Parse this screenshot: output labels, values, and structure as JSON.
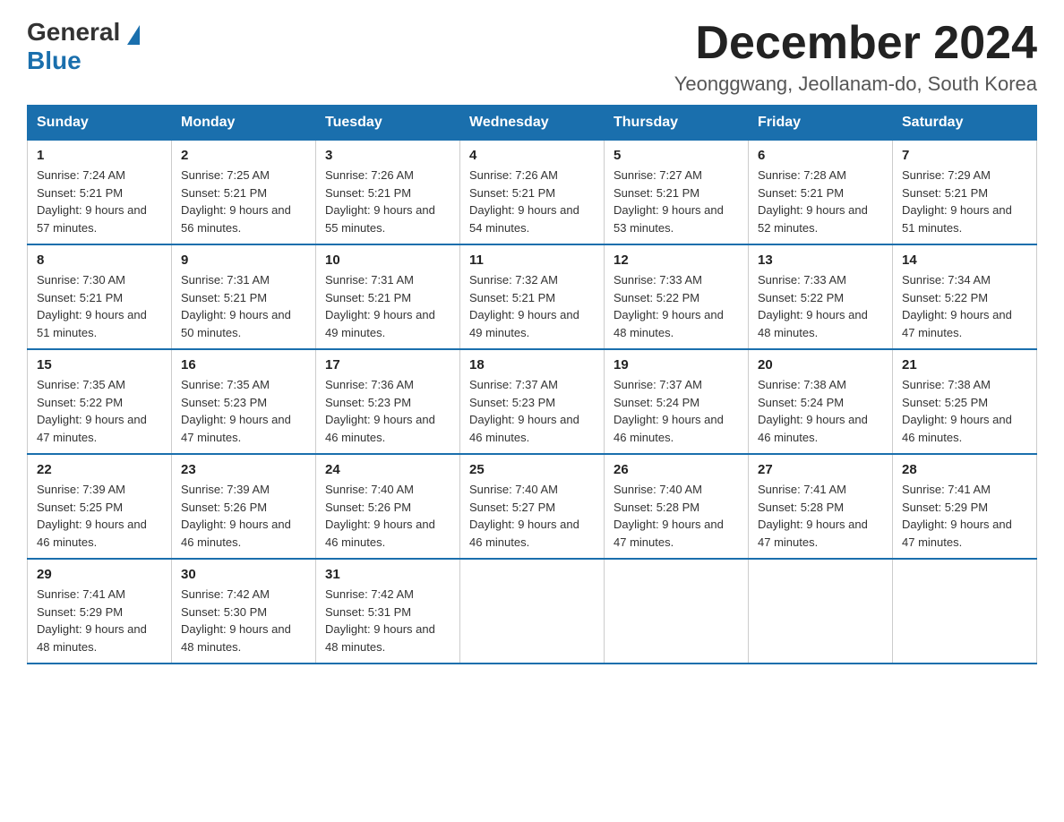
{
  "logo": {
    "general": "General",
    "blue": "Blue"
  },
  "title": "December 2024",
  "location": "Yeonggwang, Jeollanam-do, South Korea",
  "days_of_week": [
    "Sunday",
    "Monday",
    "Tuesday",
    "Wednesday",
    "Thursday",
    "Friday",
    "Saturday"
  ],
  "weeks": [
    [
      {
        "day": "1",
        "sunrise": "7:24 AM",
        "sunset": "5:21 PM",
        "daylight": "9 hours and 57 minutes."
      },
      {
        "day": "2",
        "sunrise": "7:25 AM",
        "sunset": "5:21 PM",
        "daylight": "9 hours and 56 minutes."
      },
      {
        "day": "3",
        "sunrise": "7:26 AM",
        "sunset": "5:21 PM",
        "daylight": "9 hours and 55 minutes."
      },
      {
        "day": "4",
        "sunrise": "7:26 AM",
        "sunset": "5:21 PM",
        "daylight": "9 hours and 54 minutes."
      },
      {
        "day": "5",
        "sunrise": "7:27 AM",
        "sunset": "5:21 PM",
        "daylight": "9 hours and 53 minutes."
      },
      {
        "day": "6",
        "sunrise": "7:28 AM",
        "sunset": "5:21 PM",
        "daylight": "9 hours and 52 minutes."
      },
      {
        "day": "7",
        "sunrise": "7:29 AM",
        "sunset": "5:21 PM",
        "daylight": "9 hours and 51 minutes."
      }
    ],
    [
      {
        "day": "8",
        "sunrise": "7:30 AM",
        "sunset": "5:21 PM",
        "daylight": "9 hours and 51 minutes."
      },
      {
        "day": "9",
        "sunrise": "7:31 AM",
        "sunset": "5:21 PM",
        "daylight": "9 hours and 50 minutes."
      },
      {
        "day": "10",
        "sunrise": "7:31 AM",
        "sunset": "5:21 PM",
        "daylight": "9 hours and 49 minutes."
      },
      {
        "day": "11",
        "sunrise": "7:32 AM",
        "sunset": "5:21 PM",
        "daylight": "9 hours and 49 minutes."
      },
      {
        "day": "12",
        "sunrise": "7:33 AM",
        "sunset": "5:22 PM",
        "daylight": "9 hours and 48 minutes."
      },
      {
        "day": "13",
        "sunrise": "7:33 AM",
        "sunset": "5:22 PM",
        "daylight": "9 hours and 48 minutes."
      },
      {
        "day": "14",
        "sunrise": "7:34 AM",
        "sunset": "5:22 PM",
        "daylight": "9 hours and 47 minutes."
      }
    ],
    [
      {
        "day": "15",
        "sunrise": "7:35 AM",
        "sunset": "5:22 PM",
        "daylight": "9 hours and 47 minutes."
      },
      {
        "day": "16",
        "sunrise": "7:35 AM",
        "sunset": "5:23 PM",
        "daylight": "9 hours and 47 minutes."
      },
      {
        "day": "17",
        "sunrise": "7:36 AM",
        "sunset": "5:23 PM",
        "daylight": "9 hours and 46 minutes."
      },
      {
        "day": "18",
        "sunrise": "7:37 AM",
        "sunset": "5:23 PM",
        "daylight": "9 hours and 46 minutes."
      },
      {
        "day": "19",
        "sunrise": "7:37 AM",
        "sunset": "5:24 PM",
        "daylight": "9 hours and 46 minutes."
      },
      {
        "day": "20",
        "sunrise": "7:38 AM",
        "sunset": "5:24 PM",
        "daylight": "9 hours and 46 minutes."
      },
      {
        "day": "21",
        "sunrise": "7:38 AM",
        "sunset": "5:25 PM",
        "daylight": "9 hours and 46 minutes."
      }
    ],
    [
      {
        "day": "22",
        "sunrise": "7:39 AM",
        "sunset": "5:25 PM",
        "daylight": "9 hours and 46 minutes."
      },
      {
        "day": "23",
        "sunrise": "7:39 AM",
        "sunset": "5:26 PM",
        "daylight": "9 hours and 46 minutes."
      },
      {
        "day": "24",
        "sunrise": "7:40 AM",
        "sunset": "5:26 PM",
        "daylight": "9 hours and 46 minutes."
      },
      {
        "day": "25",
        "sunrise": "7:40 AM",
        "sunset": "5:27 PM",
        "daylight": "9 hours and 46 minutes."
      },
      {
        "day": "26",
        "sunrise": "7:40 AM",
        "sunset": "5:28 PM",
        "daylight": "9 hours and 47 minutes."
      },
      {
        "day": "27",
        "sunrise": "7:41 AM",
        "sunset": "5:28 PM",
        "daylight": "9 hours and 47 minutes."
      },
      {
        "day": "28",
        "sunrise": "7:41 AM",
        "sunset": "5:29 PM",
        "daylight": "9 hours and 47 minutes."
      }
    ],
    [
      {
        "day": "29",
        "sunrise": "7:41 AM",
        "sunset": "5:29 PM",
        "daylight": "9 hours and 48 minutes."
      },
      {
        "day": "30",
        "sunrise": "7:42 AM",
        "sunset": "5:30 PM",
        "daylight": "9 hours and 48 minutes."
      },
      {
        "day": "31",
        "sunrise": "7:42 AM",
        "sunset": "5:31 PM",
        "daylight": "9 hours and 48 minutes."
      },
      null,
      null,
      null,
      null
    ]
  ]
}
